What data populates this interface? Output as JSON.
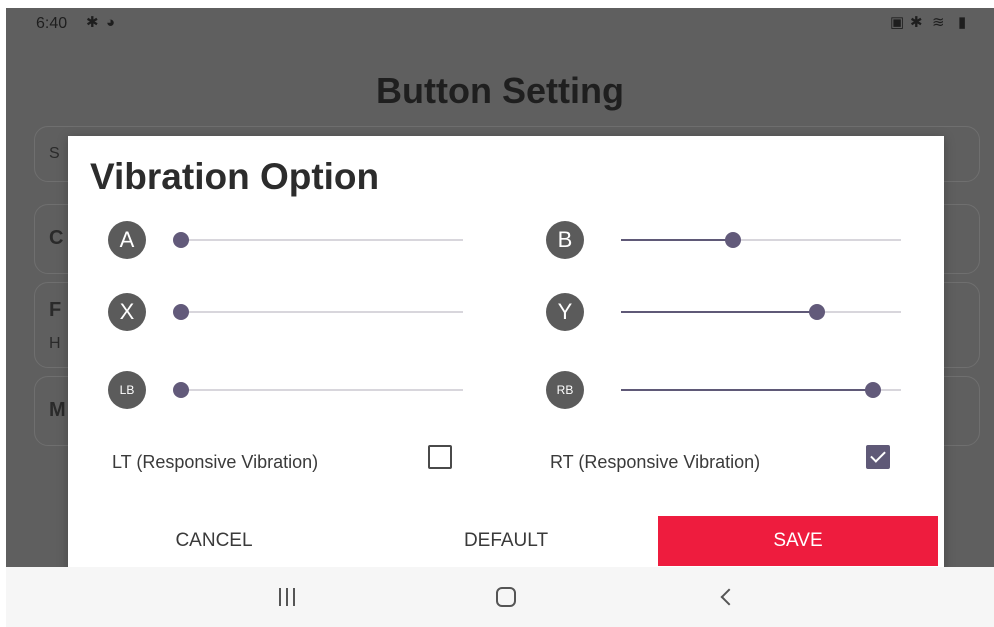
{
  "status_bar": {
    "time": "6:40",
    "left_icons": [
      "bluetooth-icon",
      "app-notification-icon"
    ],
    "right_icons": [
      "battery-saver-icon",
      "bluetooth-icon",
      "wifi-icon",
      "battery-icon"
    ]
  },
  "page": {
    "title": "Button Setting",
    "peek_texts": [
      "S",
      "C",
      "F",
      "H",
      "M"
    ]
  },
  "dialog": {
    "title": "Vibration Option",
    "sliders": [
      {
        "button": "A",
        "level": 0.0
      },
      {
        "button": "B",
        "level": 0.4
      },
      {
        "button": "X",
        "level": 0.0
      },
      {
        "button": "Y",
        "level": 0.7
      },
      {
        "button": "LB",
        "level": 0.0
      },
      {
        "button": "RB",
        "level": 0.9
      }
    ],
    "lt_label": "LT (Responsive Vibration)",
    "lt_checked": false,
    "rt_label": "RT (Responsive Vibration)",
    "rt_checked": true,
    "cancel_label": "CANCEL",
    "default_label": "DEFAULT",
    "save_label": "SAVE",
    "accent_color": "#5f5977",
    "save_color": "#ee1c3e"
  },
  "nav_bar": {
    "icons": [
      "recent-apps-icon",
      "home-icon",
      "back-icon"
    ]
  }
}
